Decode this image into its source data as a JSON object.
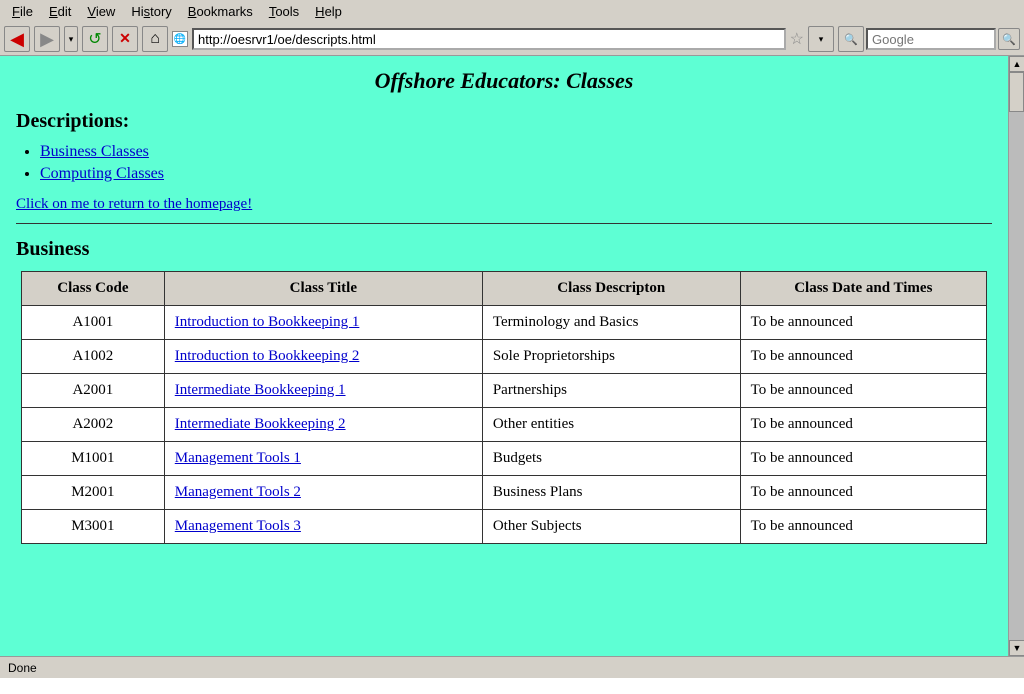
{
  "browser": {
    "menu_items": [
      "File",
      "Edit",
      "View",
      "History",
      "Bookmarks",
      "Tools",
      "Help"
    ],
    "menu_underlines": [
      0,
      0,
      0,
      0,
      0,
      0,
      0
    ],
    "url": "http://oesrvr1/oe/descripts.html",
    "search_placeholder": "Google",
    "back_btn": "◀",
    "fwd_btn": "▶",
    "reload_btn": "↺",
    "stop_btn": "✕",
    "home_btn": "🏠",
    "star_symbol": "☆",
    "search_go": "🔍",
    "scrollbar_up": "▲",
    "scrollbar_down": "▼",
    "status": "Done"
  },
  "page": {
    "title": "Offshore Educators: Classes",
    "descriptions_heading": "Descriptions:",
    "nav_links": [
      {
        "label": "Business Classes",
        "href": "#"
      },
      {
        "label": "Computing Classes",
        "href": "#"
      }
    ],
    "homepage_link": "Click on me to return to the homepage!",
    "business_heading": "Business",
    "table": {
      "headers": [
        "Class Code",
        "Class Title",
        "Class Descripton",
        "Class Date and Times"
      ],
      "rows": [
        {
          "code": "A1001",
          "title": "Introduction to Bookkeeping 1",
          "description": "Terminology and Basics",
          "dates": "To be announced"
        },
        {
          "code": "A1002",
          "title": "Introduction to Bookkeeping 2",
          "description": "Sole Proprietorships",
          "dates": "To be announced"
        },
        {
          "code": "A2001",
          "title": "Intermediate Bookkeeping 1",
          "description": "Partnerships",
          "dates": "To be announced"
        },
        {
          "code": "A2002",
          "title": "Intermediate Bookkeeping 2",
          "description": "Other entities",
          "dates": "To be announced"
        },
        {
          "code": "M1001",
          "title": "Management Tools 1",
          "description": "Budgets",
          "dates": "To be announced"
        },
        {
          "code": "M2001",
          "title": "Management Tools 2",
          "description": "Business Plans",
          "dates": "To be announced"
        },
        {
          "code": "M3001",
          "title": "Management Tools 3",
          "description": "Other Subjects",
          "dates": "To be announced"
        }
      ]
    }
  }
}
